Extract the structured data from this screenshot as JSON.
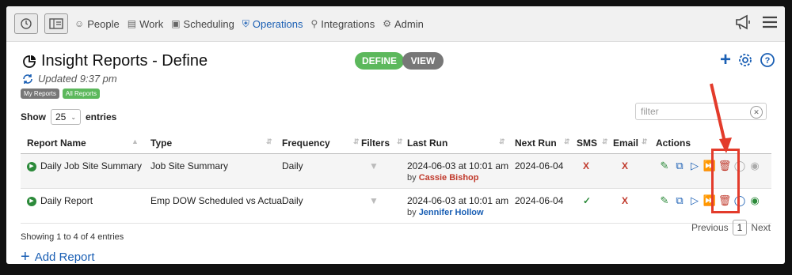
{
  "nav": {
    "items": [
      {
        "label": "People",
        "icon": "person-icon"
      },
      {
        "label": "Work",
        "icon": "work-icon"
      },
      {
        "label": "Scheduling",
        "icon": "calendar-icon"
      },
      {
        "label": "Operations",
        "icon": "shield-icon"
      },
      {
        "label": "Integrations",
        "icon": "plug-icon"
      },
      {
        "label": "Admin",
        "icon": "gear-icon"
      }
    ]
  },
  "page": {
    "title": "Insight Reports - Define",
    "define_label": "DEFINE",
    "view_label": "VIEW",
    "updated": "Updated 9:37 pm",
    "tag_my": "My Reports",
    "tag_all": "All Reports"
  },
  "controls": {
    "show_label": "Show",
    "show_value": "25",
    "entries_label": "entries",
    "filter_placeholder": "filter"
  },
  "table": {
    "headers": {
      "name": "Report Name",
      "type": "Type",
      "frequency": "Frequency",
      "filters": "Filters",
      "last_run": "Last Run",
      "next_run": "Next Run",
      "sms": "SMS",
      "email": "Email",
      "actions": "Actions"
    },
    "rows": [
      {
        "name": "Daily Job Site Summary",
        "type": "Job Site Summary",
        "frequency": "Daily",
        "last_run": "2024-06-03 at 10:01 am",
        "by_prefix": "by",
        "by": "Cassie Bishop",
        "next_run": "2024-06-04",
        "sms": "X",
        "email": "X"
      },
      {
        "name": "Daily Report",
        "type": "Emp DOW Scheduled vs Actual",
        "frequency": "Daily",
        "last_run": "2024-06-03 at 10:01 am",
        "by_prefix": "by",
        "by": "Jennifer Hollow",
        "next_run": "2024-06-04",
        "sms": "✓",
        "email": "X"
      }
    ]
  },
  "footer": {
    "showing": "Showing 1 to 4 of 4 entries",
    "previous": "Previous",
    "page": "1",
    "next": "Next",
    "add_report": "Add Report"
  },
  "colors": {
    "accent": "#1a5fb4",
    "green": "#5cb85c",
    "grey": "#777777",
    "annotation": "#e33b2b"
  }
}
